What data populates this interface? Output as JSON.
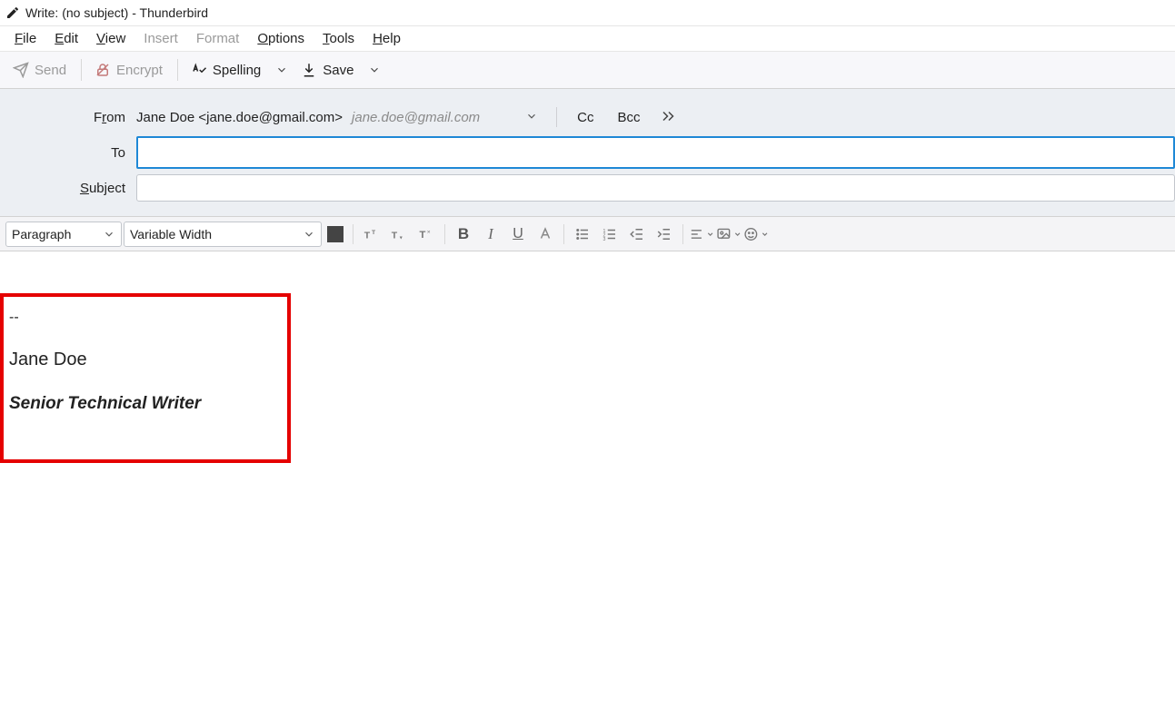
{
  "window": {
    "title": "Write: (no subject) - Thunderbird"
  },
  "menubar": {
    "file": "File",
    "edit": "Edit",
    "view": "View",
    "insert": "Insert",
    "format": "Format",
    "options": "Options",
    "tools": "Tools",
    "help": "Help"
  },
  "toolbar": {
    "send": "Send",
    "encrypt": "Encrypt",
    "spelling": "Spelling",
    "save": "Save"
  },
  "header": {
    "from_label": "From",
    "from_text": "Jane Doe <jane.doe@gmail.com>",
    "from_hint": "jane.doe@gmail.com",
    "cc": "Cc",
    "bcc": "Bcc",
    "to_label": "To",
    "to_value": "",
    "subject_label": "Subject",
    "subject_value": ""
  },
  "format": {
    "paragraph": "Paragraph",
    "font": "Variable Width"
  },
  "signature": {
    "dashes": "--",
    "name": "Jane Doe",
    "title": "Senior Technical Writer"
  }
}
